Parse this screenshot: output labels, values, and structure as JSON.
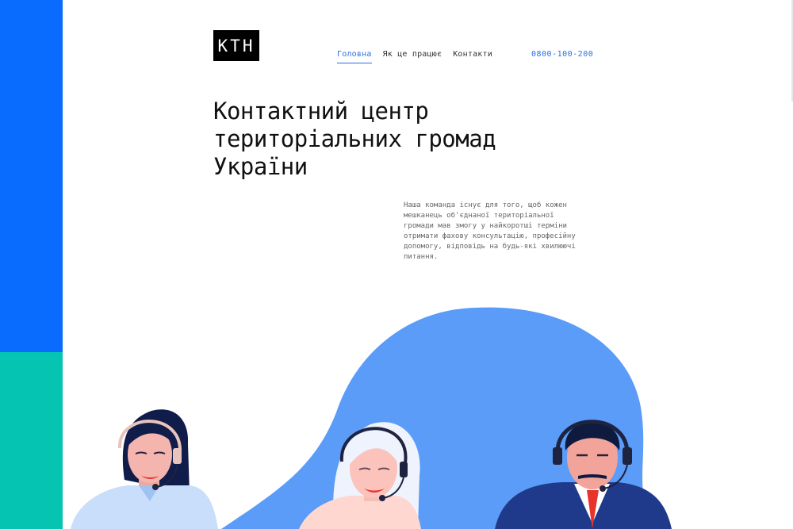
{
  "brand": {
    "logo": "КТН"
  },
  "nav": {
    "items": [
      {
        "label": "Головна",
        "active": true
      },
      {
        "label": "Як це працює",
        "active": false
      },
      {
        "label": "Контакти",
        "active": false
      }
    ],
    "phone": "0800-100-200"
  },
  "hero": {
    "title": "Контактний центр територіальних громад України",
    "description": "Наша команда існує для того, щоб кожен мешканець об'єднаної територіальної громади мав змогу у найкоротші терміни отримати фахову консультацію, професійну допомогу, відповідь на будь-які хвилюючі питання."
  },
  "colors": {
    "side_blue": "#0a6cff",
    "side_teal": "#05c4b1",
    "accent": "#2b6fe5",
    "blob": "#5a9cf8"
  },
  "illustration": {
    "subjects": [
      "operator-woman-dark-hair",
      "operator-woman-blonde",
      "operator-man-suit"
    ]
  }
}
